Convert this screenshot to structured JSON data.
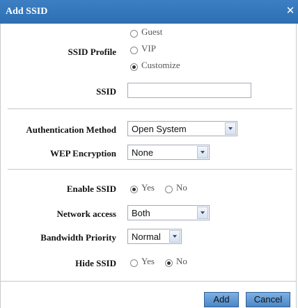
{
  "dialog": {
    "title": "Add SSID"
  },
  "ssid_profile": {
    "label": "SSID Profile",
    "options": [
      {
        "label": "Guest",
        "checked": false
      },
      {
        "label": "VIP",
        "checked": false
      },
      {
        "label": "Customize",
        "checked": true
      }
    ]
  },
  "ssid": {
    "label": "SSID",
    "value": ""
  },
  "auth": {
    "label": "Authentication Method",
    "selected": "Open System"
  },
  "wep": {
    "label": "WEP Encryption",
    "selected": "None"
  },
  "enable_ssid": {
    "label": "Enable SSID",
    "options": [
      {
        "label": "Yes",
        "checked": true
      },
      {
        "label": "No",
        "checked": false
      }
    ]
  },
  "network_access": {
    "label": "Network access",
    "selected": "Both"
  },
  "bandwidth": {
    "label": "Bandwidth Priority",
    "selected": "Normal"
  },
  "hide_ssid": {
    "label": "Hide SSID",
    "options": [
      {
        "label": "Yes",
        "checked": false
      },
      {
        "label": "No",
        "checked": true
      }
    ]
  },
  "buttons": {
    "add": "Add",
    "cancel": "Cancel"
  },
  "colors": {
    "titlebar": "#3378bd",
    "button": "#5b96d3"
  }
}
